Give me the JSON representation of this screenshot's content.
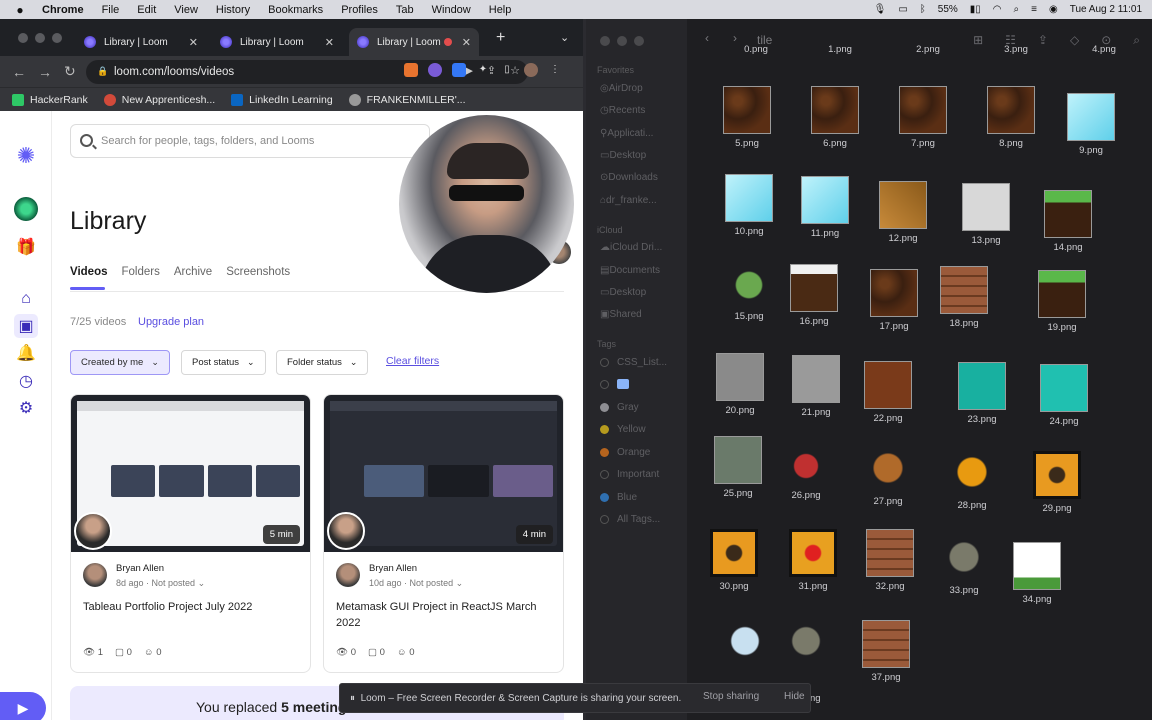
{
  "menubar": {
    "app": "Chrome",
    "items": [
      "File",
      "Edit",
      "View",
      "History",
      "Bookmarks",
      "Profiles",
      "Tab",
      "Window",
      "Help"
    ],
    "battery": "55%",
    "datetime": "Tue Aug 2  11:01"
  },
  "browser": {
    "tabs": [
      {
        "title": "Library | Loom"
      },
      {
        "title": "Library | Loom"
      },
      {
        "title": "Library | Loom"
      }
    ],
    "url": "loom.com/looms/videos",
    "bookmarks": [
      "HackerRank",
      "New Apprenticesh...",
      "LinkedIn Learning",
      "FRANKENMILLER'..."
    ]
  },
  "loom": {
    "search_placeholder": "Search for people, tags, folders, and Looms",
    "title": "Library",
    "tabs": [
      "Videos",
      "Folders",
      "Archive",
      "Screenshots"
    ],
    "count": "7/25 videos",
    "upgrade": "Upgrade plan",
    "filters": [
      "Created by me",
      "Post status",
      "Folder status"
    ],
    "clear": "Clear filters",
    "cards": [
      {
        "author": "Bryan Allen",
        "when": "8d ago",
        "status": "Not posted",
        "title": "Tableau Portfolio Project July 2022",
        "duration": "5 min",
        "views": "1",
        "comments": "0",
        "reactions": "0"
      },
      {
        "author": "Bryan Allen",
        "when": "10d ago",
        "status": "Not posted",
        "title": "Metamask GUI Project in ReactJS March 2022",
        "duration": "4 min",
        "views": "0",
        "comments": "0",
        "reactions": "0"
      }
    ],
    "banner_prefix": "You replaced ",
    "banner_bold": "5 meeting"
  },
  "finder": {
    "folder": "tile",
    "sidebar": {
      "favorites_header": "Favorites",
      "favorites": [
        "AirDrop",
        "Recents",
        "Applicati...",
        "Desktop",
        "Downloads",
        "dr_franke..."
      ],
      "icloud_header": "iCloud",
      "icloud": [
        "iCloud Dri...",
        "Documents",
        "Desktop",
        "Shared"
      ],
      "tags_header": "Tags",
      "tags": [
        "CSS_List...",
        "",
        "Gray",
        "Yellow",
        "Orange",
        "Important",
        "Blue",
        "All Tags..."
      ]
    },
    "files": [
      "0.png",
      "1.png",
      "2.png",
      "3.png",
      "4.png",
      "5.png",
      "6.png",
      "7.png",
      "8.png",
      "9.png",
      "10.png",
      "11.png",
      "12.png",
      "13.png",
      "14.png",
      "15.png",
      "16.png",
      "17.png",
      "18.png",
      "19.png",
      "20.png",
      "21.png",
      "22.png",
      "23.png",
      "24.png",
      "25.png",
      "26.png",
      "27.png",
      "28.png",
      "29.png",
      "30.png",
      "31.png",
      "32.png",
      "33.png",
      "34.png",
      "",
      "",
      "37.png"
    ],
    "partial_labels": [
      "ng"
    ]
  },
  "notice": {
    "text": "Loom – Free Screen Recorder & Screen Capture is sharing your screen.",
    "stop": "Stop sharing",
    "hide": "Hide"
  },
  "colors": {
    "accent": "#625df5",
    "chrome_dark": "#35363a",
    "finder_bg": "#1e1e21"
  }
}
